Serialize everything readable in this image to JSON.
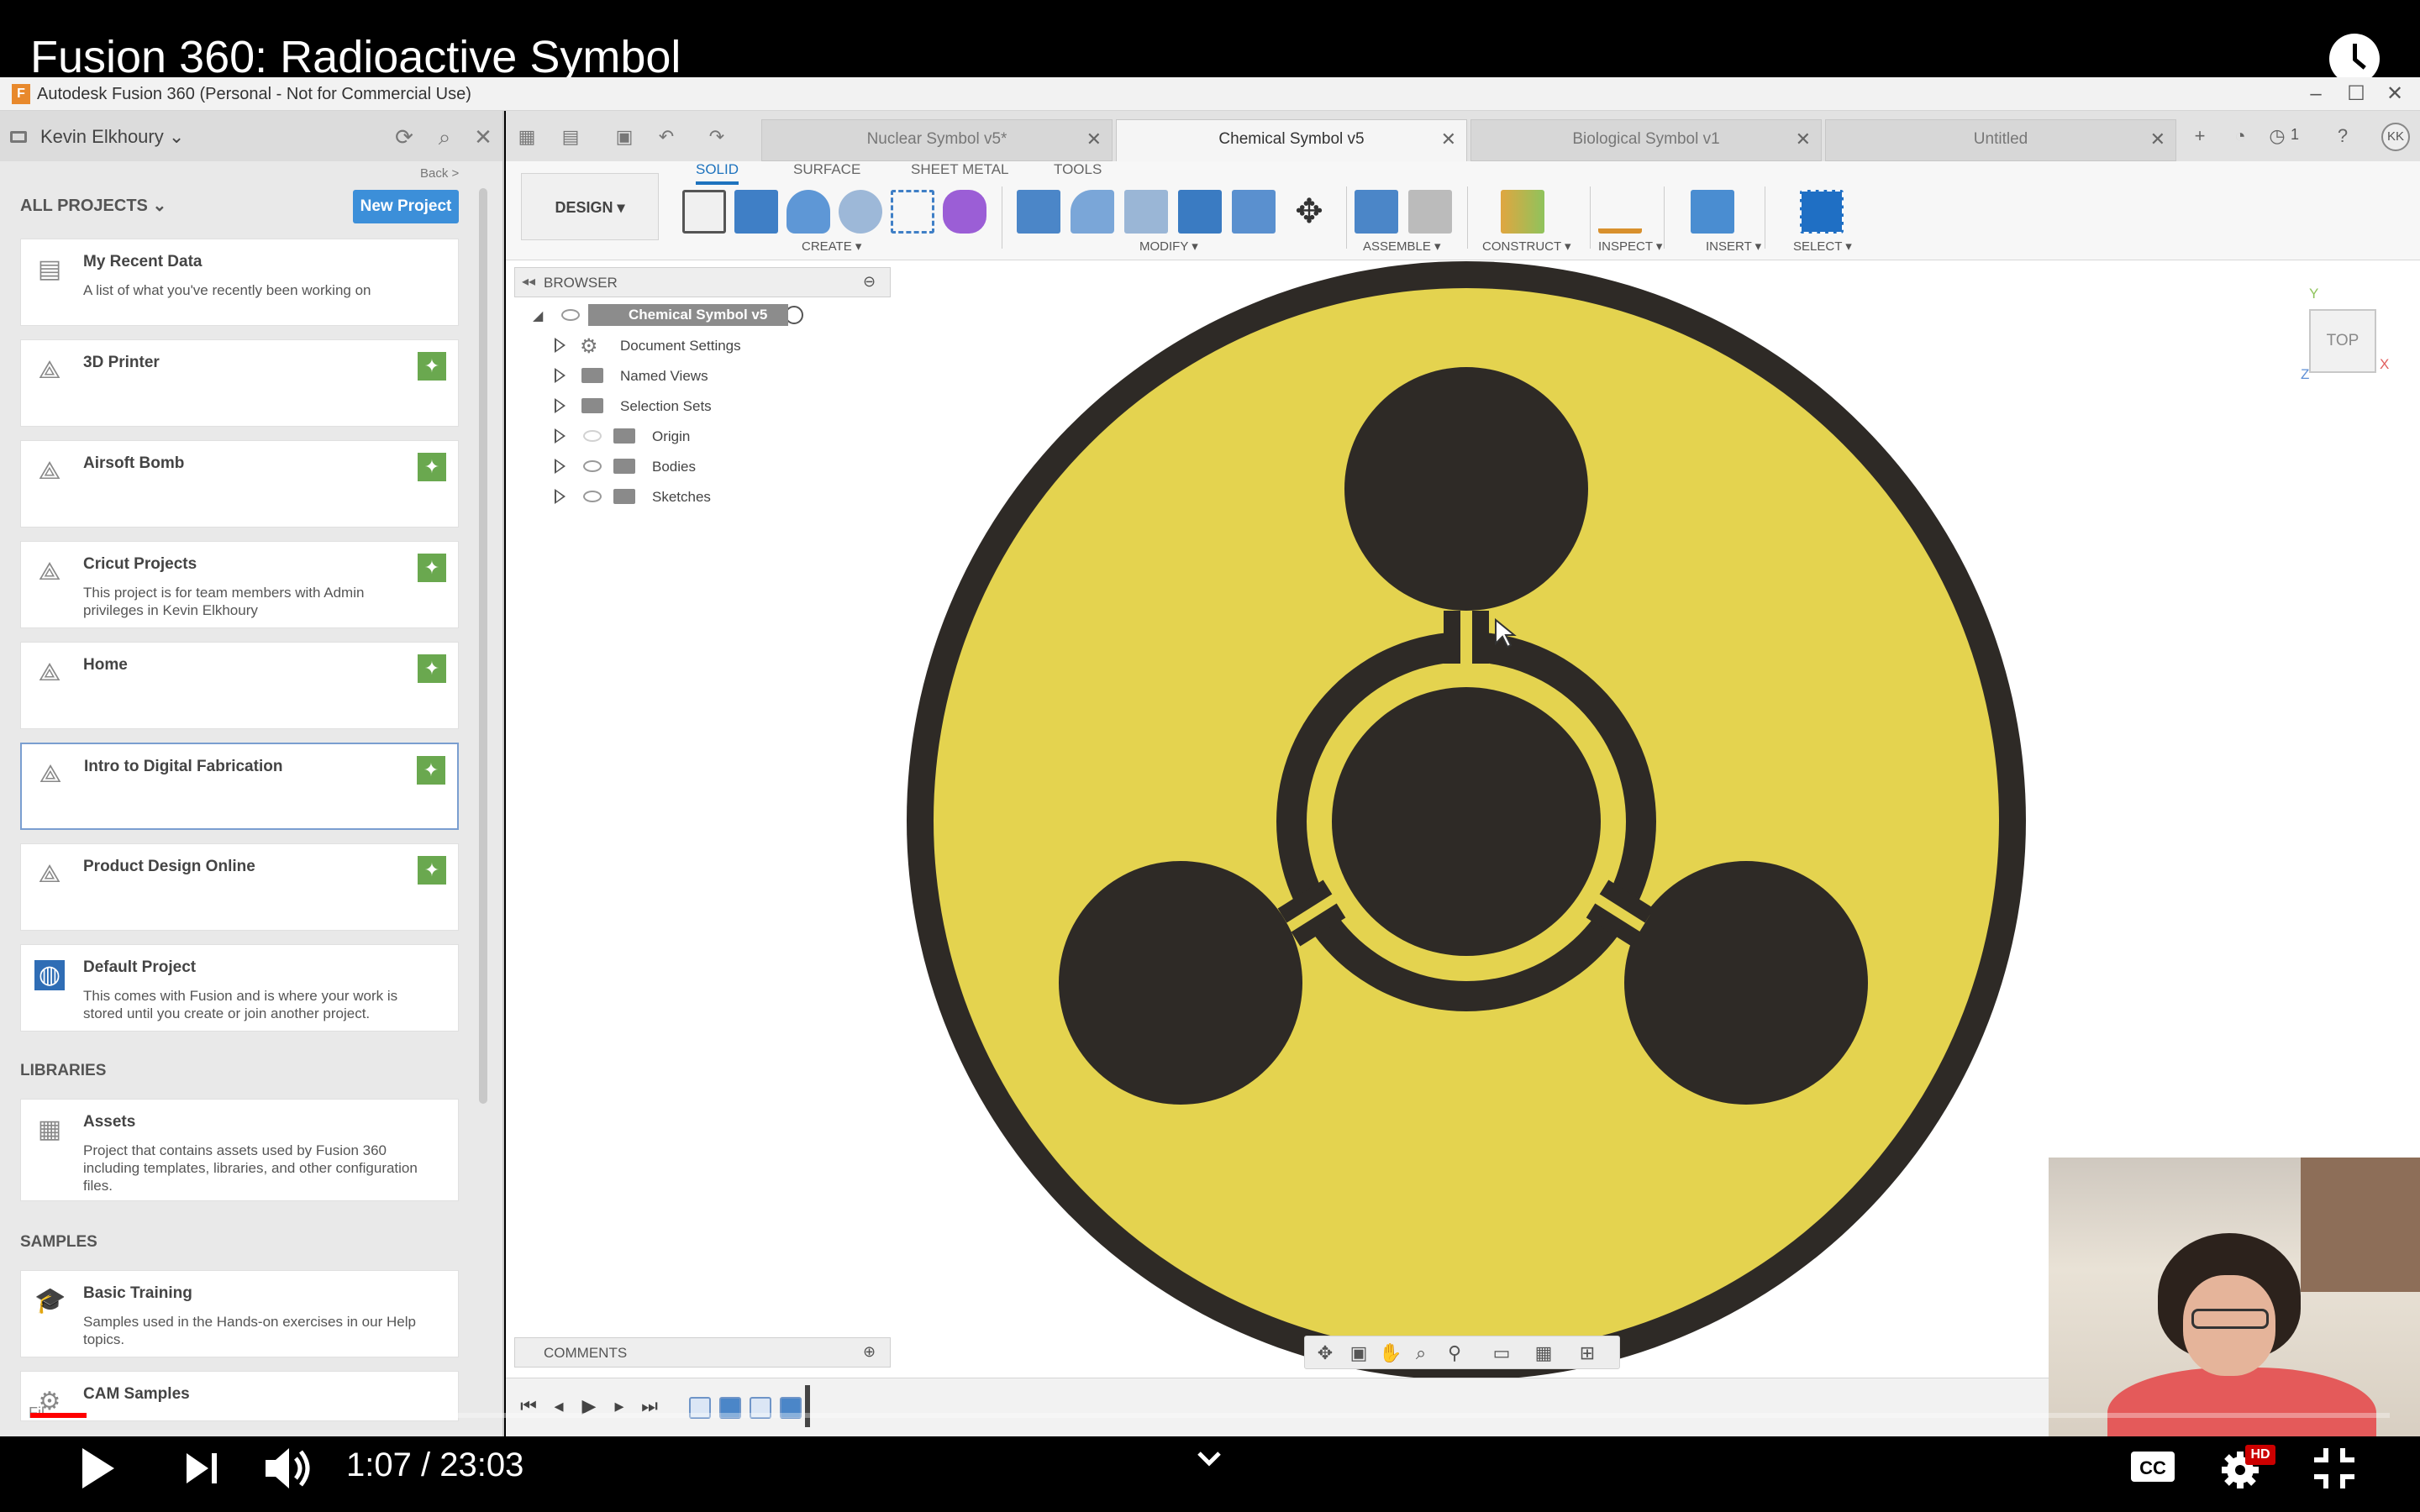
{
  "video": {
    "title": "Fusion 360: Radioactive Symbol",
    "time_current": "1:07",
    "time_separator": "/",
    "time_total": "23:03",
    "progress_played": 0.024,
    "progress_loaded": 0.036,
    "hd_badge": "HD"
  },
  "window": {
    "logo_letter": "F",
    "title": "Autodesk Fusion 360 (Personal - Not for Commercial Use)"
  },
  "data_panel": {
    "user": "Kevin Elkhoury",
    "back": "Back >",
    "all_projects": "ALL PROJECTS",
    "new_project": "New Project",
    "projects": [
      {
        "name": "My Recent Data",
        "desc": "A list of what you've recently been working on"
      },
      {
        "name": "3D Printer",
        "desc": ""
      },
      {
        "name": "Airsoft Bomb",
        "desc": ""
      },
      {
        "name": "Cricut Projects",
        "desc": "This project is for team members with Admin privileges in Kevin Elkhoury"
      },
      {
        "name": "Home",
        "desc": ""
      },
      {
        "name": "Intro to Digital Fabrication",
        "desc": ""
      },
      {
        "name": "Product Design Online",
        "desc": ""
      },
      {
        "name": "Default Project",
        "desc": "This comes with Fusion and is where your work is stored until you create or join another project."
      }
    ],
    "libraries_label": "LIBRARIES",
    "libraries": [
      {
        "name": "Assets",
        "desc": "Project that contains assets used by Fusion 360 including templates, libraries, and other configuration files."
      }
    ],
    "samples_label": "SAMPLES",
    "samples": [
      {
        "name": "Basic Training",
        "desc": "Samples used in the Hands-on exercises in our Help topics."
      },
      {
        "name": "CAM Samples",
        "desc": ""
      }
    ],
    "footer_partial": "Fil"
  },
  "tabs": [
    {
      "label": "Nuclear Symbol v5*",
      "active": false
    },
    {
      "label": "Chemical Symbol v5",
      "active": true
    },
    {
      "label": "Biological Symbol v1",
      "active": false
    },
    {
      "label": "Untitled",
      "active": false
    }
  ],
  "tab_bar": {
    "job_count": "1",
    "avatar": "KK"
  },
  "toolbar": {
    "workspace": "DESIGN",
    "workspace_tabs": [
      "SOLID",
      "SURFACE",
      "SHEET METAL",
      "TOOLS"
    ],
    "active_workspace_tab": "SOLID",
    "groups": [
      "CREATE",
      "MODIFY",
      "ASSEMBLE",
      "CONSTRUCT",
      "INSPECT",
      "INSERT",
      "SELECT"
    ]
  },
  "browser": {
    "title": "BROWSER",
    "root": "Chemical Symbol v5",
    "items": [
      "Document Settings",
      "Named Views",
      "Selection Sets",
      "Origin",
      "Bodies",
      "Sketches"
    ]
  },
  "viewcube": {
    "face": "TOP",
    "axis_y": "Y",
    "axis_x": "X",
    "axis_z": "Z"
  },
  "comments": {
    "title": "COMMENTS"
  },
  "colors": {
    "symbol_yellow": "#e4d34f",
    "symbol_dark": "#2e2a26",
    "accent_blue": "#1e73be",
    "pin_green": "#6aa84f",
    "progress_red": "#ff0000"
  },
  "icons": [
    "clock-icon",
    "play-icon",
    "next-icon",
    "volume-icon",
    "chevron-down-icon",
    "cc-icon",
    "settings-icon",
    "exit-fullscreen-icon"
  ]
}
